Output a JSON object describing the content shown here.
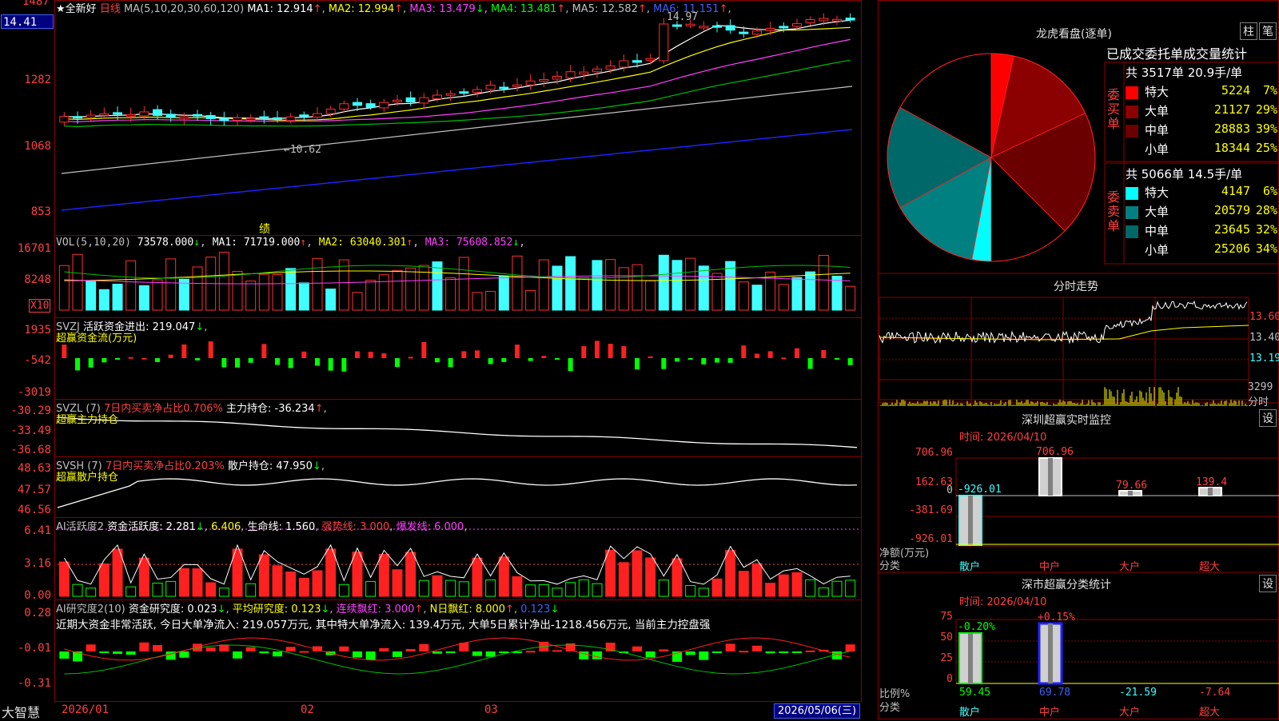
{
  "stock": {
    "star": "★",
    "name": "全新好",
    "period": "日线",
    "current_price": "14.41",
    "top_price": "1487"
  },
  "ma_line": {
    "label": "MA(5,10,20,30,60,120)",
    "items": [
      {
        "name": "MA1:",
        "value": "12.914",
        "arrow": "↑",
        "color": "#ffffff"
      },
      {
        "name": "MA2:",
        "value": "12.994",
        "arrow": "↑",
        "color": "#ffff00"
      },
      {
        "name": "MA3:",
        "value": "13.479",
        "arrow": "↓",
        "color": "#ff40ff"
      },
      {
        "name": "MA4:",
        "value": "13.481",
        "arrow": "↑",
        "color": "#00ff00"
      },
      {
        "name": "MA5:",
        "value": "12.582",
        "arrow": "↑",
        "color": "#c0c0c0"
      },
      {
        "name": "MA6:",
        "value": "11.151",
        "arrow": "↑",
        "color": "#4060ff"
      }
    ]
  },
  "price_axis": [
    "1282",
    "1068",
    "853"
  ],
  "price_annot": {
    "high": "14.97",
    "low": "←10.62",
    "marker": "绩"
  },
  "vol": {
    "label": "VOL(5,10,20)",
    "value": "73578.000",
    "arrow": "↓",
    "items": [
      {
        "name": "MA1:",
        "value": "71719.000",
        "arrow": "↑",
        "color": "#ffffff"
      },
      {
        "name": "MA2:",
        "value": "63040.301",
        "arrow": "↑",
        "color": "#ffff00"
      },
      {
        "name": "MA3:",
        "value": "75608.852",
        "arrow": "↓",
        "color": "#ff40ff"
      }
    ],
    "axis": [
      "16701",
      "8248"
    ],
    "unit": "X10"
  },
  "svzj": {
    "label": "SVZJ",
    "title": "活跃资金进出:",
    "value": "219.047",
    "arrow": "↓",
    "sub": "超赢资金流(万元)",
    "axis": [
      "1935",
      "-542",
      "-3019"
    ]
  },
  "svzl": {
    "label": "SVZL (7)",
    "title": "7日内买卖净占比",
    "pct": "0.706%",
    "hold_label": "主力持仓:",
    "hold_value": "-36.234",
    "arrow": "↑",
    "sub": "超赢主力持仓",
    "axis": [
      "-30.29",
      "-33.49",
      "-36.68"
    ]
  },
  "svsh": {
    "label": "SVSH (7)",
    "title": "7日内买卖净占比",
    "pct": "0.203%",
    "hold_label": "散户持仓:",
    "hold_value": "47.950",
    "arrow": "↓",
    "sub": "超赢散户持仓",
    "axis": [
      "48.63",
      "47.57",
      "46.56"
    ]
  },
  "ai_active": {
    "label": "AI活跃度2",
    "t1": "资金活跃度:",
    "v1": "2.281",
    "a1": "↓",
    "v2": "6.406",
    "t3": "生命线:",
    "v3": "1.560",
    "t4": "强势线:",
    "v4": "3.000",
    "t5": "爆发线:",
    "v5": "6.000",
    "axis": [
      "6.41",
      "3.16",
      "0.00"
    ]
  },
  "ai_research": {
    "label": "AI研究度2(10)",
    "t1": "资金研究度:",
    "v1": "0.023",
    "a1": "↓",
    "t2": "平均研究度:",
    "v2": "0.123",
    "a2": "↓",
    "t3": "连续飘红:",
    "v3": "3.000",
    "a3": "↑",
    "t4": "N日飘红:",
    "v4": "8.000",
    "a4": "↑",
    "v5": "0.123",
    "a5": "↓",
    "summary": "近期大资金非常活跃, 今日大单净流入: 219.057万元, 其中特大单净流入: 139.4万元, 大单5日累计净出-1218.456万元, 当前主力控盘强",
    "axis": [
      "0.28",
      "-0.01",
      "-0.31"
    ]
  },
  "x_axis": {
    "brand": "大智慧",
    "labels": [
      "2026/01",
      "02",
      "03"
    ],
    "cursor_date": "2026/05/06(三)"
  },
  "right": {
    "dragon_title": "龙虎看盘(逐单)",
    "btn_bar": "柱",
    "btn_pen": "笔",
    "stat_title": "已成交委托单成交量统计",
    "buy": {
      "side": "委买单",
      "summary": "共 3517单 20.9手/单",
      "rows": [
        {
          "label": "特大",
          "value": "5224",
          "pct": "7%",
          "color": "#ff0000"
        },
        {
          "label": "大单",
          "value": "21127",
          "pct": "29%",
          "color": "#8b0000"
        },
        {
          "label": "中单",
          "value": "28883",
          "pct": "39%",
          "color": "#6b0000"
        },
        {
          "label": "小单",
          "value": "18344",
          "pct": "25%",
          "color": "#000000"
        }
      ]
    },
    "sell": {
      "side": "委卖单",
      "summary": "共 5066单 14.5手/单",
      "rows": [
        {
          "label": "特大",
          "value": "4147",
          "pct": "6%",
          "color": "#00ffff"
        },
        {
          "label": "大单",
          "value": "20579",
          "pct": "28%",
          "color": "#008080"
        },
        {
          "label": "中单",
          "value": "23645",
          "pct": "32%",
          "color": "#006868"
        },
        {
          "label": "小单",
          "value": "25206",
          "pct": "34%",
          "color": "#000000"
        }
      ]
    },
    "intraday_title": "分时走势",
    "intraday_axis": [
      "13.60",
      "13.40",
      "13.19"
    ],
    "intraday_vol": "3299",
    "intraday_vol_label": "分时",
    "monitor": {
      "title": "深圳超赢实时监控",
      "btn": "设",
      "time": "时间: 2026/04/10",
      "axis": [
        "706.96",
        "162.63",
        "0",
        "-381.69",
        "-926.01"
      ],
      "bar_values": [
        "-926.01",
        "706.96",
        "79.66",
        "139.4"
      ],
      "y_title": "净额(万元)",
      "x_title": "分类",
      "cats": [
        "散户",
        "中户",
        "大户",
        "超大"
      ]
    },
    "classify": {
      "title": "深市超赢分类统计",
      "btn": "设",
      "time": "时间: 2026/04/10",
      "axis": [
        "75",
        "50",
        "25",
        "0"
      ],
      "bar_top": [
        "-0.20%",
        "+0.15%"
      ],
      "values": [
        "59.45",
        "69.78",
        "-21.59",
        "-7.64"
      ],
      "y_title": "比例%",
      "x_title": "分类",
      "cats": [
        "散户",
        "中户",
        "大户",
        "超大"
      ]
    }
  }
}
